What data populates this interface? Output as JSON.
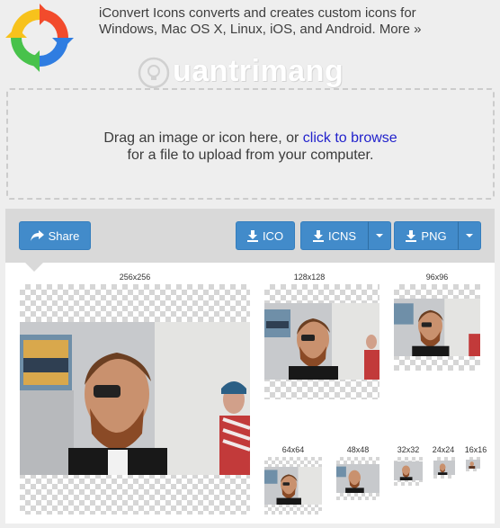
{
  "header": {
    "tagline_line1": "iConvert Icons converts and creates custom icons for",
    "tagline_line2": "Windows, Mac OS X, Linux, iOS, and Android.",
    "more_link": "More »",
    "logo_icon": "iconvert-arrows-logo",
    "watermark": "uantrimang"
  },
  "dropzone": {
    "line1_prefix": "Drag an image or icon here, or ",
    "browse_link": "click to browse",
    "line2": "for a file to upload from your computer."
  },
  "toolbar": {
    "share_label": "Share",
    "ico_label": "ICO",
    "icns_label": "ICNS",
    "png_label": "PNG"
  },
  "sizes": {
    "s256": "256x256",
    "s128": "128x128",
    "s96": "96x96",
    "s64": "64x64",
    "s48": "48x48",
    "s32": "32x32",
    "s24": "24x24",
    "s16": "16x16"
  },
  "colors": {
    "button_blue": "#428bca",
    "link_blue": "#2222cc",
    "toolbar_gray": "#d9d9d9"
  }
}
